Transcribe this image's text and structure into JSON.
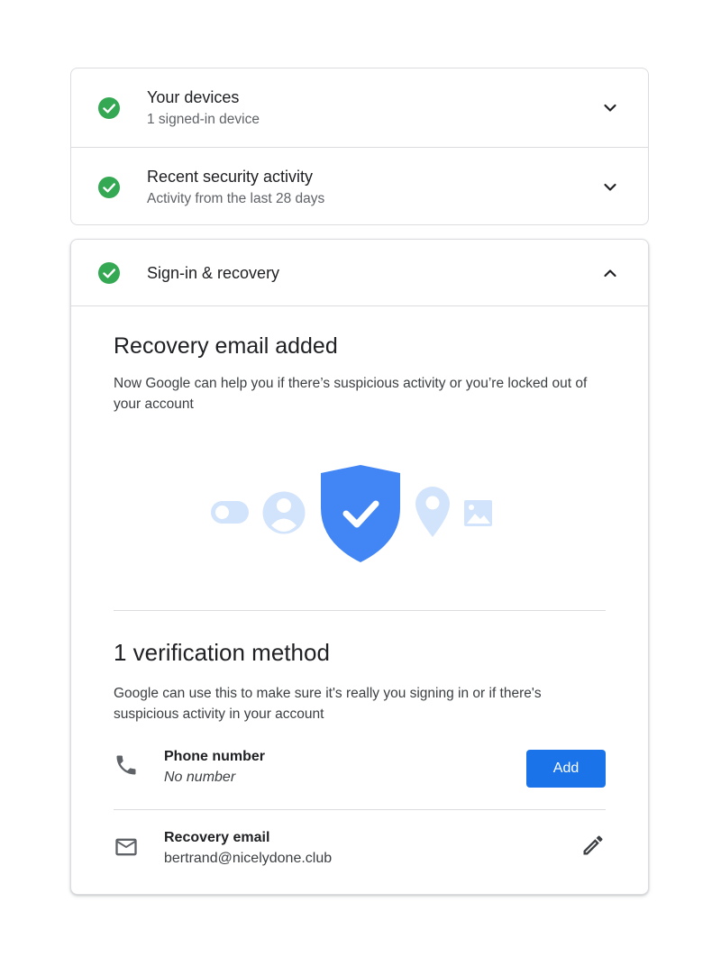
{
  "devices": {
    "title": "Your devices",
    "subtitle": "1 signed-in device"
  },
  "security_activity": {
    "title": "Recent security activity",
    "subtitle": "Activity from the last 28 days"
  },
  "signin_recovery": {
    "title": "Sign-in & recovery",
    "recovery_heading": "Recovery email added",
    "recovery_text": "Now Google can help you if there’s suspicious activity or you’re locked out of your account",
    "verification_heading": "1 verification method",
    "verification_text": "Google can use this to make sure it's really you signing in or if there's suspicious activity in your account",
    "phone": {
      "label": "Phone number",
      "value": "No number",
      "button": "Add"
    },
    "email": {
      "label": "Recovery email",
      "value": "bertrand@nicelydone.club"
    }
  },
  "colors": {
    "success": "#34a853",
    "primary": "#1a73e8",
    "shield": "#4285f4",
    "light_blue": "#d2e3fc"
  },
  "icons": [
    "check-circle-icon",
    "chevron-down-icon",
    "chevron-up-icon",
    "phone-icon",
    "mail-icon",
    "pencil-icon",
    "shield-check-icon",
    "toggle-icon",
    "account-circle-icon",
    "location-pin-icon",
    "image-icon"
  ]
}
